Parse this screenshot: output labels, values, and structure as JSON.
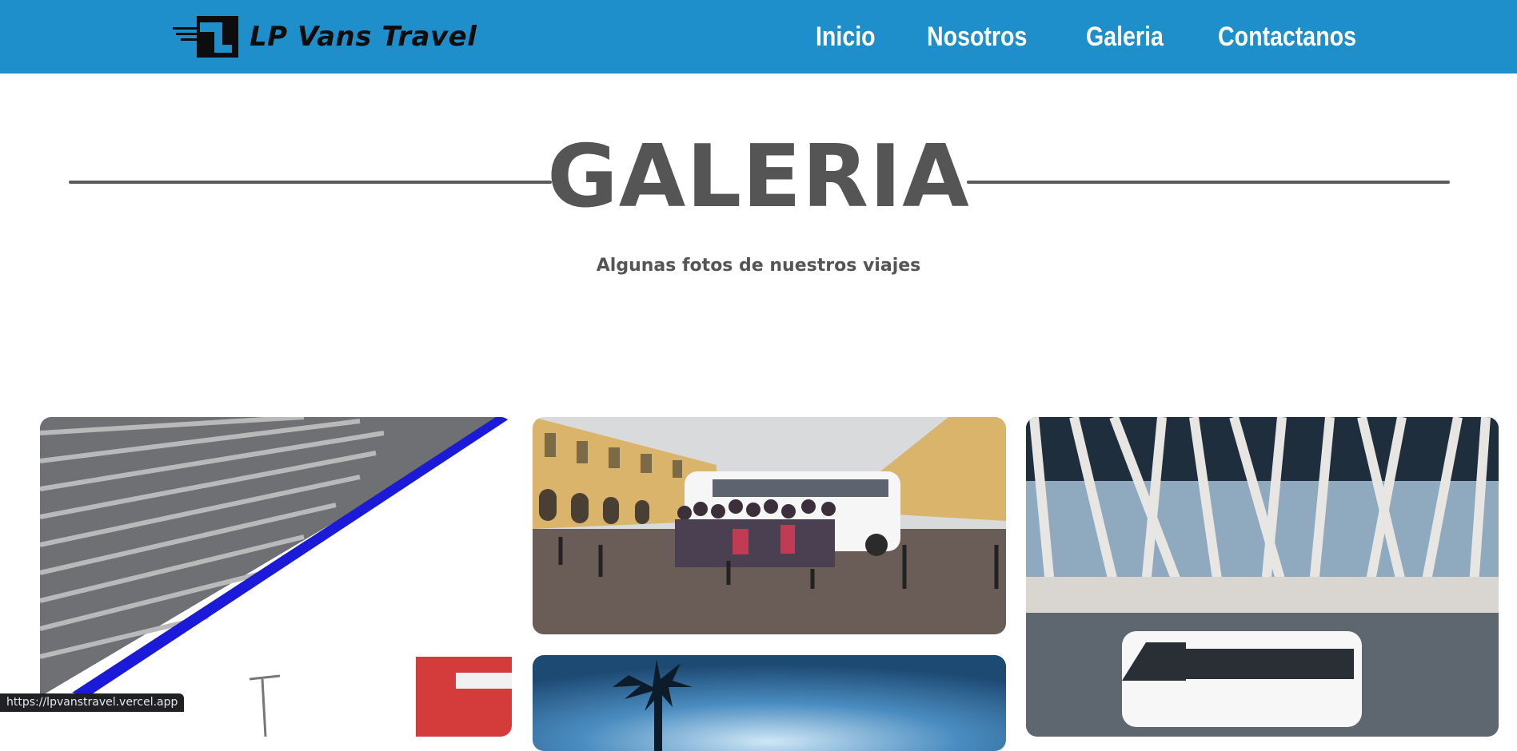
{
  "header": {
    "brand": "LP Vans Travel",
    "nav": [
      {
        "label": "Inicio"
      },
      {
        "label": "Nosotros"
      },
      {
        "label": "Galeria"
      },
      {
        "label": "Contactanos"
      }
    ],
    "color": "#1f8fcc"
  },
  "section": {
    "title": "GALERIA",
    "subtitle": "Algunas fotos de nuestros viajes"
  },
  "status_bar": {
    "url": "https://lpvanstravel.vercel.app"
  },
  "colors": {
    "nav_bg": "#1f8fcc",
    "heading_text": "#555555"
  }
}
